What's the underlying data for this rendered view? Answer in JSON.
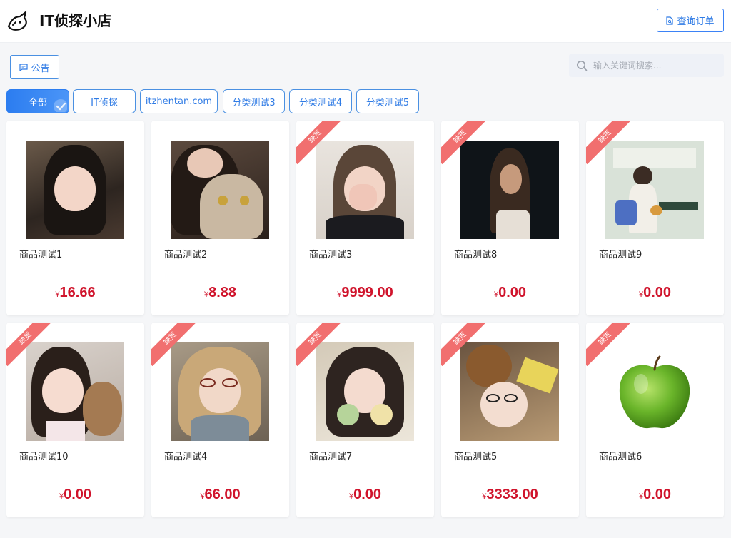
{
  "header": {
    "title": "IT侦探小店",
    "order_button": "查询订单"
  },
  "toolbar": {
    "notice_button": "公告",
    "search_placeholder": "输入关键词搜索..."
  },
  "tabs": [
    {
      "label": "全部",
      "active": true
    },
    {
      "label": "IT侦探",
      "active": false
    },
    {
      "label": "itzhentan.com",
      "active": false
    },
    {
      "label": "分类测试3",
      "active": false
    },
    {
      "label": "分类测试4",
      "active": false
    },
    {
      "label": "分类测试5",
      "active": false
    }
  ],
  "currency_symbol": "¥",
  "out_of_stock_label": "缺货",
  "products": [
    {
      "name": "商品测试1",
      "price": "16.66",
      "out_of_stock": false,
      "image": "portrait-girl-dark-hair"
    },
    {
      "name": "商品测试2",
      "price": "8.88",
      "out_of_stock": false,
      "image": "girl-with-cat"
    },
    {
      "name": "商品测试3",
      "price": "9999.00",
      "out_of_stock": true,
      "image": "girl-covering-face"
    },
    {
      "name": "商品测试8",
      "price": "0.00",
      "out_of_stock": true,
      "image": "girl-silhouette-dark"
    },
    {
      "name": "商品测试9",
      "price": "0.00",
      "out_of_stock": true,
      "image": "girl-sitting-bench"
    },
    {
      "name": "商品测试10",
      "price": "0.00",
      "out_of_stock": true,
      "image": "girl-with-teddy"
    },
    {
      "name": "商品测试4",
      "price": "66.00",
      "out_of_stock": true,
      "image": "child-with-glasses"
    },
    {
      "name": "商品测试7",
      "price": "0.00",
      "out_of_stock": true,
      "image": "girl-with-toys"
    },
    {
      "name": "商品测试5",
      "price": "3333.00",
      "out_of_stock": true,
      "image": "girl-teddy-bear"
    },
    {
      "name": "商品测试6",
      "price": "0.00",
      "out_of_stock": true,
      "image": "green-apple"
    }
  ],
  "colors": {
    "primary": "#2f7be5",
    "price": "#d0142c",
    "ribbon": "#f16f6f",
    "background": "#f5f6f8"
  }
}
